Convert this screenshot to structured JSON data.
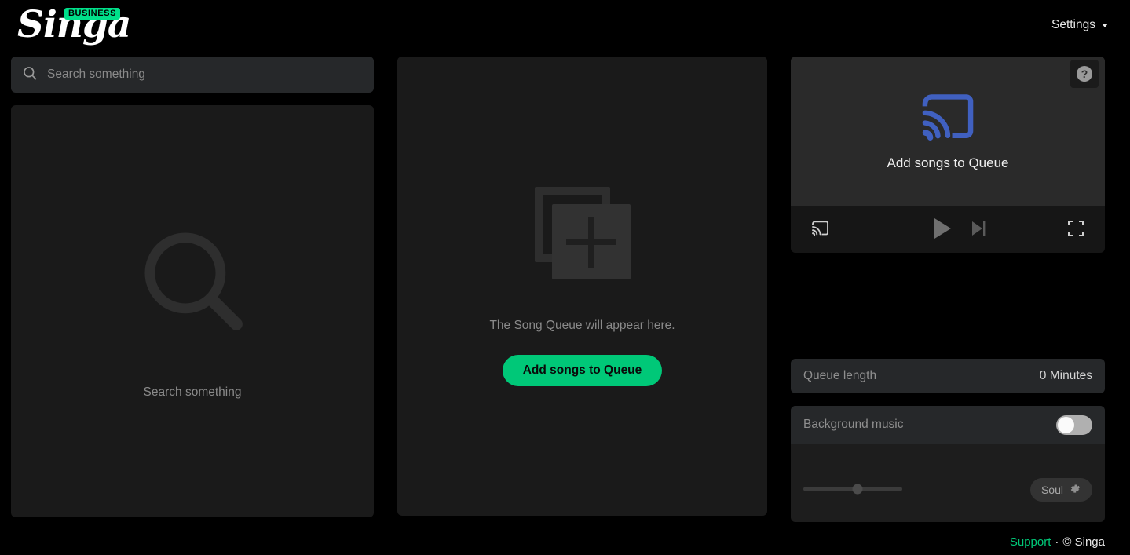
{
  "header": {
    "logo_text": "Singa",
    "logo_badge": "BUSINESS",
    "settings_label": "Settings",
    "settings_icon": "chevron-down-icon"
  },
  "search": {
    "placeholder": "Search something",
    "value": "",
    "icon": "search-icon",
    "empty_state": {
      "icon": "search-icon",
      "label": "Search something"
    }
  },
  "queue": {
    "empty_state": {
      "icon": "add-to-queue-icon",
      "label": "The Song Queue will appear here.",
      "button_label": "Add songs to Queue"
    }
  },
  "player": {
    "help_button_icon": "question-mark-icon",
    "help_button_label": "?",
    "stage_icon": "cast-icon",
    "stage_label": "Add songs to Queue",
    "controls": {
      "cast_icon": "cast-icon",
      "play_icon": "play-icon",
      "next_icon": "skip-next-icon",
      "fullscreen_icon": "fullscreen-icon"
    }
  },
  "queue_length": {
    "label": "Queue length",
    "value": "0 Minutes"
  },
  "background_music": {
    "label": "Background music",
    "toggle_state": "off",
    "volume_percent": 55,
    "genre_label": "Soul",
    "genre_icon": "gear-icon"
  },
  "footer": {
    "support_label": "Support",
    "separator": "·",
    "copyright": "© Singa"
  },
  "colors": {
    "accent_green": "#00c878",
    "badge_green": "#00e08a",
    "cast_blue": "#4060c0",
    "background": "#000000",
    "panel": "#1a1a1a",
    "field": "#26282a"
  }
}
